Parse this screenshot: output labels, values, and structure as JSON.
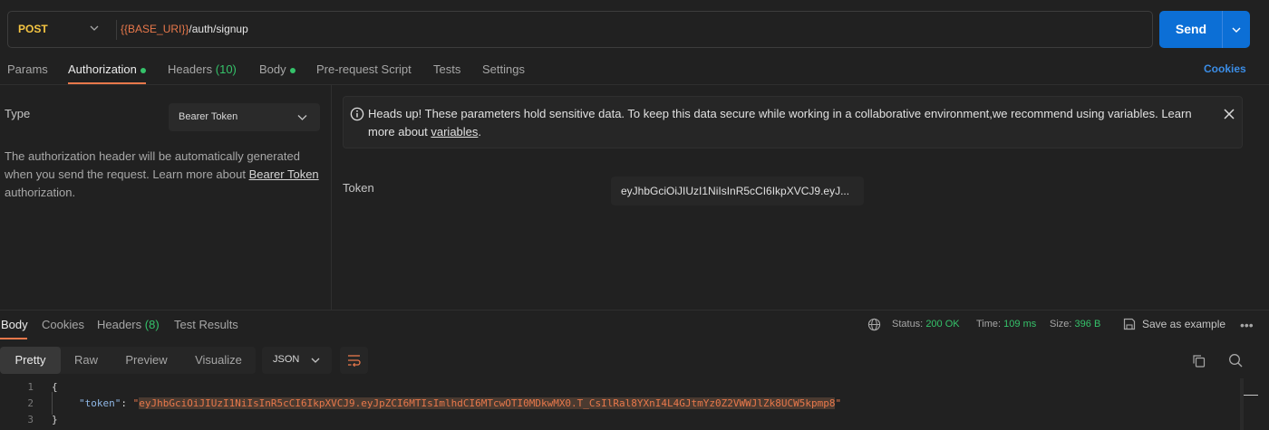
{
  "request": {
    "method": "POST",
    "url_var": "{{BASE_URI}}",
    "url_path": "/auth/signup",
    "send_label": "Send"
  },
  "request_tabs": {
    "params": "Params",
    "authorization": "Authorization",
    "headers": "Headers",
    "headers_count": "(10)",
    "body": "Body",
    "pre_request": "Pre-request Script",
    "tests": "Tests",
    "settings": "Settings",
    "cookies": "Cookies"
  },
  "auth": {
    "type_label": "Type",
    "type_value": "Bearer Token",
    "desc_before": "The authorization header will be automatically generated when you send the request. Learn more about ",
    "desc_link": "Bearer Token",
    "desc_after": " authorization."
  },
  "banner": {
    "text_before": "Heads up! These parameters hold sensitive data. To keep this data secure while working in a collaborative environment,we recommend using variables. Learn more about ",
    "link": "variables",
    "text_after": "."
  },
  "token": {
    "label": "Token",
    "value": "eyJhbGciOiJIUzI1NiIsInR5cCI6IkpXVCJ9.eyJ..."
  },
  "response_tabs": {
    "body": "Body",
    "cookies": "Cookies",
    "headers": "Headers",
    "headers_count": "(8)",
    "test_results": "Test Results"
  },
  "response_meta": {
    "status_label": "Status:",
    "status_value": "200 OK",
    "time_label": "Time:",
    "time_value": "109 ms",
    "size_label": "Size:",
    "size_value": "396 B",
    "save_example": "Save as example"
  },
  "view_modes": {
    "pretty": "Pretty",
    "raw": "Raw",
    "preview": "Preview",
    "visualize": "Visualize",
    "format": "JSON"
  },
  "code": {
    "line_numbers": [
      "1",
      "2",
      "3"
    ],
    "open_brace": "{",
    "key": "\"token\"",
    "colon": ": ",
    "quote": "\"",
    "token_value": "eyJhbGciOiJIUzI1NiIsInR5cCI6IkpXVCJ9.eyJpZCI6MTIsImlhdCI6MTcwOTI0MDkwMX0.T_CsIlRal8YXnI4L4GJtmYz0Z2VWWJlZk8UCW5kpmp8",
    "close_brace": "}"
  },
  "colors": {
    "accent": "#e8784b",
    "send": "#0c6fd6",
    "success": "#35c26a",
    "method": "#f5c542",
    "link": "#3b8de6"
  },
  "icons": [
    "chevron-down-icon",
    "info-icon",
    "close-icon",
    "globe-icon",
    "save-icon",
    "more-icon",
    "wrap-lines-icon",
    "copy-icon",
    "search-icon"
  ]
}
